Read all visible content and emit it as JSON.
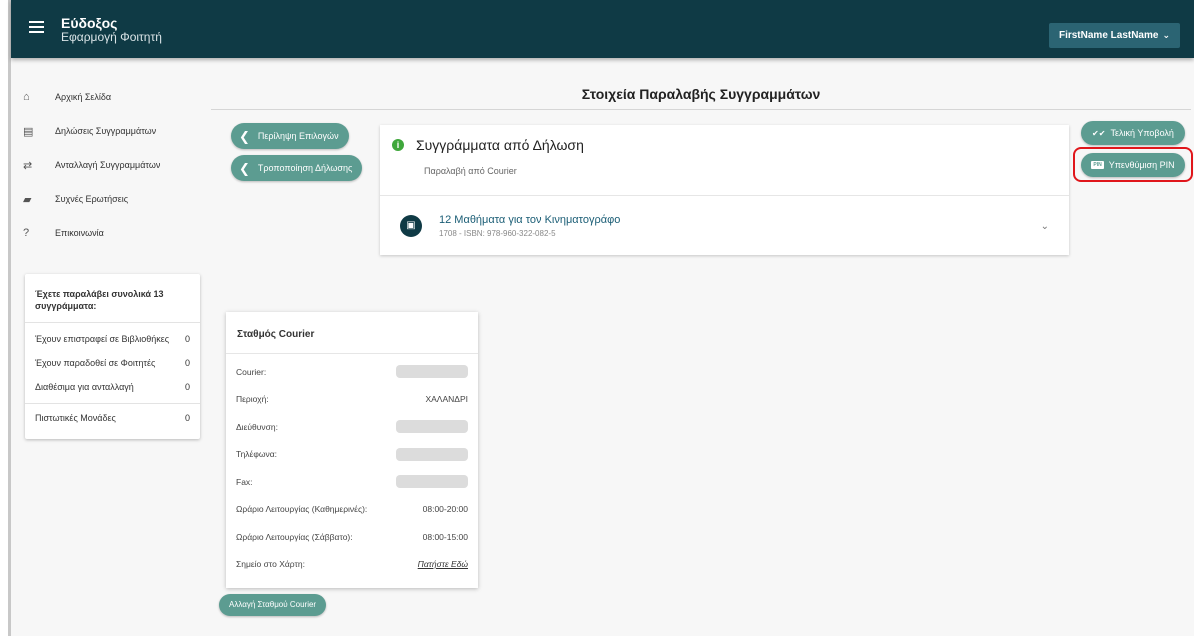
{
  "header": {
    "brand_title": "Εύδοξος",
    "brand_subtitle": "Εφαρμογή Φοιτητή",
    "user_name": "FirstName LastName",
    "user_chevron": "⌄"
  },
  "sidebar": {
    "items": [
      {
        "icon": "home-icon",
        "glyph": "⌂",
        "label": "Αρχική Σελίδα"
      },
      {
        "icon": "document-list-icon",
        "glyph": "▤",
        "label": "Δηλώσεις Συγγραμμάτων"
      },
      {
        "icon": "exchange-icon",
        "glyph": "⇄",
        "label": "Ανταλλαγή Συγγραμμάτων"
      },
      {
        "icon": "chat-icon",
        "glyph": "▰",
        "label": "Συχνές Ερωτήσεις"
      },
      {
        "icon": "help-icon",
        "glyph": "?",
        "label": "Επικοινωνία"
      }
    ]
  },
  "summary": {
    "heading": "Έχετε παραλάβει συνολικά 13 συγγράμματα:",
    "rows": [
      {
        "label": "Έχουν επιστραφεί σε Βιβλιοθήκες",
        "value": "0"
      },
      {
        "label": "Έχουν παραδοθεί σε Φοιτητές",
        "value": "0"
      },
      {
        "label": "Διαθέσιμα για ανταλλαγή",
        "value": "0"
      },
      {
        "label": "Πιστωτικές Μονάδες",
        "value": "0"
      }
    ]
  },
  "main": {
    "title": "Στοιχεία Παραλαβής Συγγραμμάτων",
    "summary_button": "Περίληψη Επιλογών",
    "modify_button": "Τροποποίηση Δήλωσης",
    "back_glyph": "❮"
  },
  "books": {
    "title": "Συγγράμματα από Δήλωση",
    "subtitle": "Παραλαβή από Courier",
    "info_glyph": "i",
    "items": [
      {
        "title": "12 Μαθήματα για τον Κινηματογράφο",
        "meta": "1708 - ISBN: 978-960-322-082-5",
        "glyph": "▣",
        "chevron": "⌄"
      }
    ]
  },
  "courier": {
    "heading": "Σταθμός Courier",
    "rows": [
      {
        "label": "Courier:",
        "value": "",
        "redacted": true
      },
      {
        "label": "Περιοχή:",
        "value": "ΧΑΛΑΝΔΡΙ",
        "redacted": false
      },
      {
        "label": "Διεύθυνση:",
        "value": "",
        "redacted": true
      },
      {
        "label": "Τηλέφωνα:",
        "value": "",
        "redacted": true
      },
      {
        "label": "Fax:",
        "value": "",
        "redacted": true
      },
      {
        "label": "Ωράριο Λειτουργίας (Καθημερινές):",
        "value": "08:00-20:00",
        "redacted": false
      },
      {
        "label": "Ωράριο Λειτουργίας (Σάββατο):",
        "value": "08:00-15:00",
        "redacted": false
      },
      {
        "label": "Σημείο στο Χάρτη:",
        "value": "Πατήστε Εδώ",
        "redacted": false,
        "link": true
      }
    ],
    "change_button": "Αλλαγή Σταθμού Courier"
  },
  "actions": {
    "submit_label": "Τελική Υποβολή",
    "submit_glyph": "✔✔",
    "pin_label": "Υπενθύμιση PIN",
    "pin_badge": "PIN"
  },
  "colors": {
    "header_bg": "#0f3a45",
    "accent": "#5c9c91",
    "highlight": "#e0161b",
    "link": "#1a5d75"
  }
}
